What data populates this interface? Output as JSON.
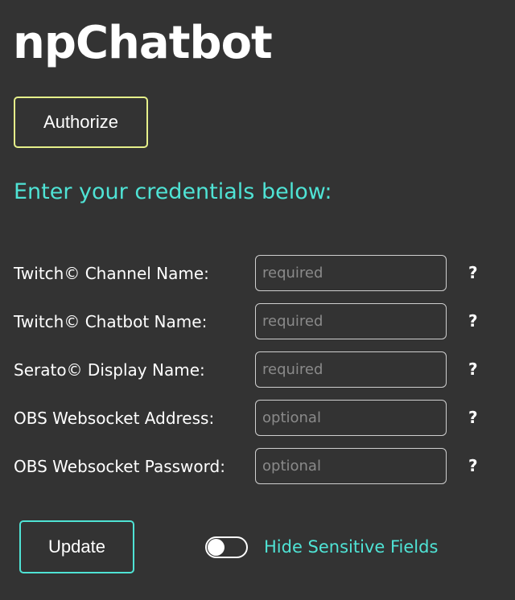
{
  "app": {
    "title": "npChatbot"
  },
  "auth": {
    "button_label": "Authorize"
  },
  "form": {
    "heading": "Enter your credentials below:",
    "fields": [
      {
        "label": "Twitch© Channel Name:",
        "placeholder": "required",
        "value": "",
        "help": "?"
      },
      {
        "label": "Twitch© Chatbot Name:",
        "placeholder": "required",
        "value": "",
        "help": "?"
      },
      {
        "label": "Serato© Display Name:",
        "placeholder": "required",
        "value": "",
        "help": "?"
      },
      {
        "label": "OBS Websocket Address:",
        "placeholder": "optional",
        "value": "",
        "help": "?"
      },
      {
        "label": "OBS Websocket Password:",
        "placeholder": "optional",
        "value": "",
        "help": "?"
      }
    ],
    "update_label": "Update",
    "toggle": {
      "label": "Hide Sensitive Fields",
      "checked": false
    }
  },
  "colors": {
    "background": "#333333",
    "accent_teal": "#4fe3d5",
    "authorize_border": "#e6f08a",
    "text": "#ffffff"
  }
}
